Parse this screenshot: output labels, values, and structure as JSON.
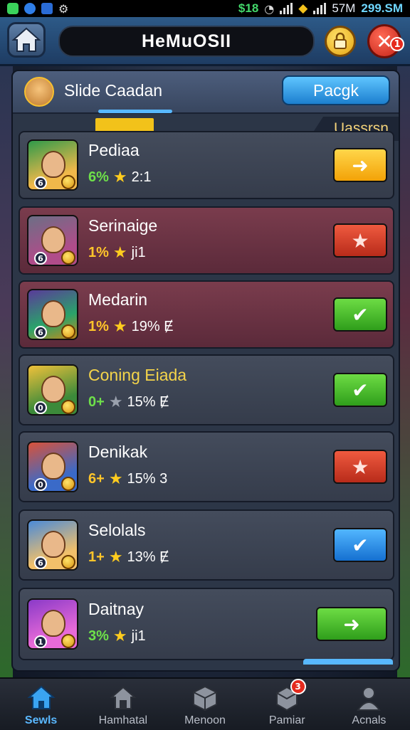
{
  "status_bar": {
    "left_icons": [
      "app-icon",
      "notification-icon",
      "bluetooth-icon",
      "settings-icon"
    ],
    "data_speed": "$18",
    "battery_label": "57M",
    "time": "299.SM"
  },
  "header": {
    "title": "HeMuOSII",
    "close_badge": "1"
  },
  "panel": {
    "title": "Slide Caadan",
    "button_label": "Pacgk",
    "corner_label": "Uassrsn"
  },
  "rows": [
    {
      "name": "Pediaa",
      "level": "6",
      "stat1": "6%",
      "stat2": "2:1",
      "star": "gold",
      "action": "arrow",
      "action_color": "#f6b40e",
      "row_style": "dark"
    },
    {
      "name": "Serinaige",
      "level": "6",
      "stat1": "1%",
      "stat2": "ji1",
      "star": "gold",
      "action": "star",
      "action_color": "#d23a24",
      "row_style": "red"
    },
    {
      "name": "Medarin",
      "level": "6",
      "stat1": "1%",
      "stat2": "19% Ɇ",
      "star": "gold",
      "action": "check",
      "action_color": "#3db526",
      "row_style": "red"
    },
    {
      "name": "Coning Eiada",
      "level": "0",
      "stat1": "0+",
      "stat2": "15% Ɇ",
      "star": "grey",
      "action": "check",
      "action_color": "#3db526",
      "row_style": "dark",
      "name_color": "#f4d44a"
    },
    {
      "name": "Denikak",
      "level": "0",
      "stat1": "6+",
      "stat2": "15% 3",
      "star": "gold",
      "action": "star",
      "action_color": "#d23a24",
      "row_style": "dark"
    },
    {
      "name": "Selolals",
      "level": "6",
      "stat1": "1+",
      "stat2": "13% Ɇ",
      "star": "gold",
      "action": "check",
      "action_color": "#1f83de",
      "row_style": "dark"
    },
    {
      "name": "Daitnay",
      "level": "1",
      "stat1": "3%",
      "stat2": "ji1",
      "star": "gold",
      "action": "arrow",
      "action_color": "#3db526",
      "row_style": "dark"
    }
  ],
  "bottom_nav": [
    {
      "label": "Sewls",
      "icon": "home-icon",
      "active": true
    },
    {
      "label": "Hamhatal",
      "icon": "house-icon",
      "active": false
    },
    {
      "label": "Menoon",
      "icon": "cube-icon",
      "active": false
    },
    {
      "label": "Pamiar",
      "icon": "box-icon",
      "active": false,
      "badge": "3"
    },
    {
      "label": "Acnals",
      "icon": "user-icon",
      "active": false
    }
  ],
  "colors": {
    "accent": "#58b8ff",
    "header": "#2d5a88",
    "panel": "#2c3647",
    "gold": "#ffcc1e"
  }
}
